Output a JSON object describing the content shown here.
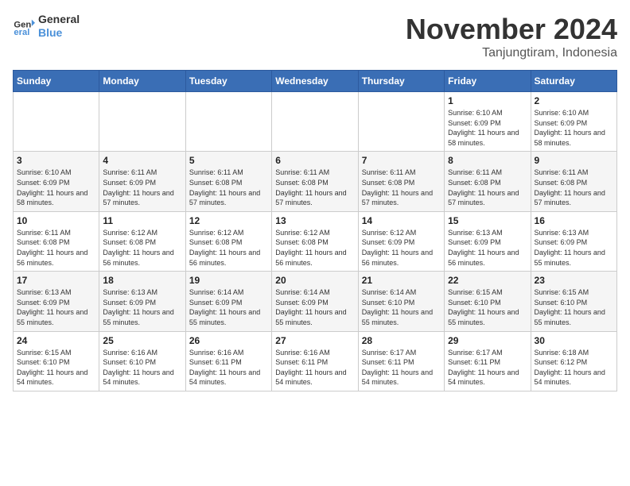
{
  "header": {
    "logo_line1": "General",
    "logo_line2": "Blue",
    "month_title": "November 2024",
    "location": "Tanjungtiram, Indonesia"
  },
  "weekdays": [
    "Sunday",
    "Monday",
    "Tuesday",
    "Wednesday",
    "Thursday",
    "Friday",
    "Saturday"
  ],
  "weeks": [
    [
      {
        "day": "",
        "info": ""
      },
      {
        "day": "",
        "info": ""
      },
      {
        "day": "",
        "info": ""
      },
      {
        "day": "",
        "info": ""
      },
      {
        "day": "",
        "info": ""
      },
      {
        "day": "1",
        "info": "Sunrise: 6:10 AM\nSunset: 6:09 PM\nDaylight: 11 hours and 58 minutes."
      },
      {
        "day": "2",
        "info": "Sunrise: 6:10 AM\nSunset: 6:09 PM\nDaylight: 11 hours and 58 minutes."
      }
    ],
    [
      {
        "day": "3",
        "info": "Sunrise: 6:10 AM\nSunset: 6:09 PM\nDaylight: 11 hours and 58 minutes."
      },
      {
        "day": "4",
        "info": "Sunrise: 6:11 AM\nSunset: 6:09 PM\nDaylight: 11 hours and 57 minutes."
      },
      {
        "day": "5",
        "info": "Sunrise: 6:11 AM\nSunset: 6:08 PM\nDaylight: 11 hours and 57 minutes."
      },
      {
        "day": "6",
        "info": "Sunrise: 6:11 AM\nSunset: 6:08 PM\nDaylight: 11 hours and 57 minutes."
      },
      {
        "day": "7",
        "info": "Sunrise: 6:11 AM\nSunset: 6:08 PM\nDaylight: 11 hours and 57 minutes."
      },
      {
        "day": "8",
        "info": "Sunrise: 6:11 AM\nSunset: 6:08 PM\nDaylight: 11 hours and 57 minutes."
      },
      {
        "day": "9",
        "info": "Sunrise: 6:11 AM\nSunset: 6:08 PM\nDaylight: 11 hours and 57 minutes."
      }
    ],
    [
      {
        "day": "10",
        "info": "Sunrise: 6:11 AM\nSunset: 6:08 PM\nDaylight: 11 hours and 56 minutes."
      },
      {
        "day": "11",
        "info": "Sunrise: 6:12 AM\nSunset: 6:08 PM\nDaylight: 11 hours and 56 minutes."
      },
      {
        "day": "12",
        "info": "Sunrise: 6:12 AM\nSunset: 6:08 PM\nDaylight: 11 hours and 56 minutes."
      },
      {
        "day": "13",
        "info": "Sunrise: 6:12 AM\nSunset: 6:08 PM\nDaylight: 11 hours and 56 minutes."
      },
      {
        "day": "14",
        "info": "Sunrise: 6:12 AM\nSunset: 6:09 PM\nDaylight: 11 hours and 56 minutes."
      },
      {
        "day": "15",
        "info": "Sunrise: 6:13 AM\nSunset: 6:09 PM\nDaylight: 11 hours and 56 minutes."
      },
      {
        "day": "16",
        "info": "Sunrise: 6:13 AM\nSunset: 6:09 PM\nDaylight: 11 hours and 55 minutes."
      }
    ],
    [
      {
        "day": "17",
        "info": "Sunrise: 6:13 AM\nSunset: 6:09 PM\nDaylight: 11 hours and 55 minutes."
      },
      {
        "day": "18",
        "info": "Sunrise: 6:13 AM\nSunset: 6:09 PM\nDaylight: 11 hours and 55 minutes."
      },
      {
        "day": "19",
        "info": "Sunrise: 6:14 AM\nSunset: 6:09 PM\nDaylight: 11 hours and 55 minutes."
      },
      {
        "day": "20",
        "info": "Sunrise: 6:14 AM\nSunset: 6:09 PM\nDaylight: 11 hours and 55 minutes."
      },
      {
        "day": "21",
        "info": "Sunrise: 6:14 AM\nSunset: 6:10 PM\nDaylight: 11 hours and 55 minutes."
      },
      {
        "day": "22",
        "info": "Sunrise: 6:15 AM\nSunset: 6:10 PM\nDaylight: 11 hours and 55 minutes."
      },
      {
        "day": "23",
        "info": "Sunrise: 6:15 AM\nSunset: 6:10 PM\nDaylight: 11 hours and 55 minutes."
      }
    ],
    [
      {
        "day": "24",
        "info": "Sunrise: 6:15 AM\nSunset: 6:10 PM\nDaylight: 11 hours and 54 minutes."
      },
      {
        "day": "25",
        "info": "Sunrise: 6:16 AM\nSunset: 6:10 PM\nDaylight: 11 hours and 54 minutes."
      },
      {
        "day": "26",
        "info": "Sunrise: 6:16 AM\nSunset: 6:11 PM\nDaylight: 11 hours and 54 minutes."
      },
      {
        "day": "27",
        "info": "Sunrise: 6:16 AM\nSunset: 6:11 PM\nDaylight: 11 hours and 54 minutes."
      },
      {
        "day": "28",
        "info": "Sunrise: 6:17 AM\nSunset: 6:11 PM\nDaylight: 11 hours and 54 minutes."
      },
      {
        "day": "29",
        "info": "Sunrise: 6:17 AM\nSunset: 6:11 PM\nDaylight: 11 hours and 54 minutes."
      },
      {
        "day": "30",
        "info": "Sunrise: 6:18 AM\nSunset: 6:12 PM\nDaylight: 11 hours and 54 minutes."
      }
    ]
  ]
}
